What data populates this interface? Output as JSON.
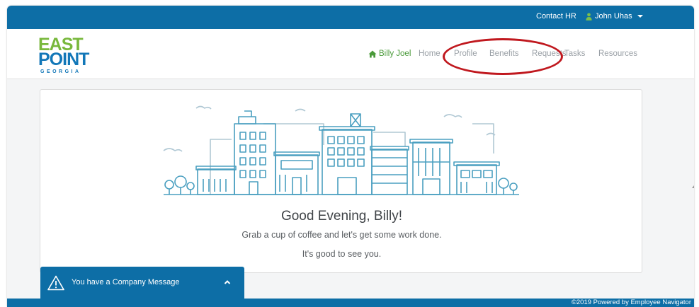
{
  "topbar": {
    "contact_label": "Contact HR",
    "user_name": "John Uhas"
  },
  "logo": {
    "line1": "EAST",
    "line2": "POINT",
    "line3": "GEORGIA"
  },
  "nav": {
    "home_user": "Billy Joel",
    "items": [
      "Home",
      "Profile",
      "Benefits",
      "Requests",
      "Tasks",
      "Resources"
    ]
  },
  "welcome": {
    "greeting": "Good Evening, Billy!",
    "line1": "Grab a cup of coffee and let's get some work done.",
    "line2": "It's good to see you."
  },
  "message_bar": {
    "text": "You have a Company Message"
  },
  "footer": {
    "powered": "©2019 Powered by Employee Navigator"
  },
  "colors": {
    "brand_blue": "#0d6ea6",
    "logo_green": "#78b83c",
    "annotation_red": "#c0181e",
    "illustration": "#4a9fc0"
  },
  "icons": {
    "home": "house-icon",
    "user": "person-icon",
    "caret": "caret-down-icon",
    "warning": "warning-triangle-icon",
    "chevron": "chevron-up-icon"
  }
}
